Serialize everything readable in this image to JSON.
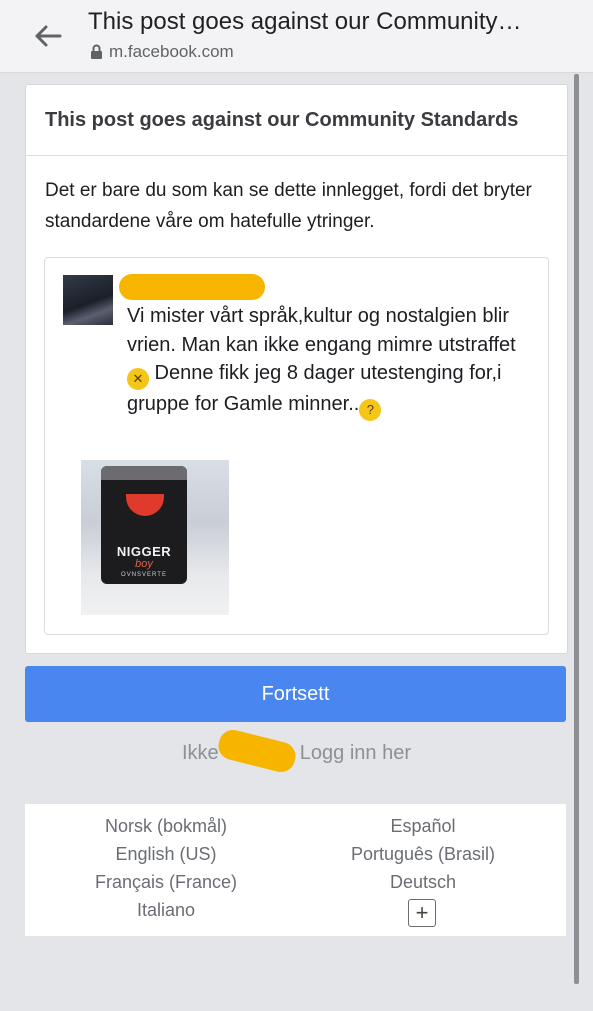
{
  "browser": {
    "title": "This post goes against our Community…",
    "url": "m.facebook.com"
  },
  "card": {
    "header": "This post goes against our Community Standards",
    "message": "Det er bare du som kan se dette innlegget, fordi det bryter standardene våre om hatefulle ytringer."
  },
  "post": {
    "text_part1": "Vi mister vårt språk,kultur og nostalgien blir vrien. Man kan ikke engang mimre utstraffet",
    "text_part2": " Denne fikk jeg 8 dager utestenging for,i gruppe for Gamle minner..",
    "emoji1": "crying-face-emoji",
    "emoji2": "thinking-face-emoji",
    "image_label_main": "NIGGER",
    "image_label_script": "boy",
    "image_label_small": "OVNSVERTE"
  },
  "actions": {
    "continue_label": "Fortsett",
    "not_you_prefix": "Ikke",
    "not_you_suffix": "Logg inn her"
  },
  "languages": {
    "left": [
      "Norsk (bokmål)",
      "English (US)",
      "Français (France)",
      "Italiano"
    ],
    "right": [
      "Español",
      "Português (Brasil)",
      "Deutsch"
    ],
    "more_icon": "plus-icon"
  },
  "colors": {
    "primary_button": "#4a86f0",
    "redaction": "#f7b500"
  }
}
